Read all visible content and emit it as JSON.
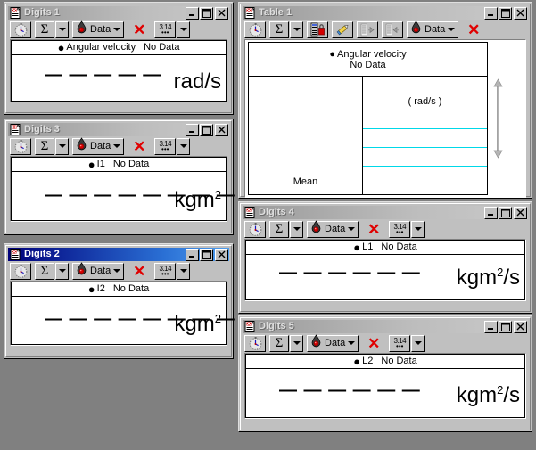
{
  "desktop": {
    "background": "#808080"
  },
  "windows": [
    {
      "id": "digits1",
      "title": "Digits 1",
      "active": false,
      "type": "digits",
      "icon": "document-meter-icon",
      "toolbar": {
        "timer_icon": "stopwatch-icon",
        "sigma_label": "Σ",
        "sigma_dropdown": "chevron-down-icon",
        "data_label": "Data",
        "data_icon": "probe-icon",
        "data_dropdown": "chevron-down-icon",
        "close_label": "✕",
        "pi_top": "3.14",
        "pi_bottom": "•••",
        "pi_dropdown": "chevron-down-icon"
      },
      "header": {
        "series": "Angular velocity",
        "status": "No Data"
      },
      "value": "— — — — —",
      "unit": "rad/s",
      "unit_sup": "",
      "unit_tail": ""
    },
    {
      "id": "digits3",
      "title": "Digits 3",
      "active": false,
      "type": "digits",
      "icon": "document-meter-icon",
      "toolbar": {
        "timer_icon": "stopwatch-icon",
        "sigma_label": "Σ",
        "sigma_dropdown": "chevron-down-icon",
        "data_label": "Data",
        "data_icon": "probe-icon",
        "data_dropdown": "chevron-down-icon",
        "close_label": "✕",
        "pi_top": "3.14",
        "pi_bottom": "•••",
        "pi_dropdown": "chevron-down-icon"
      },
      "header": {
        "series": "I1",
        "status": "No Data"
      },
      "value": "— — — — — — — —",
      "unit": "kgm",
      "unit_sup": "2",
      "unit_tail": ""
    },
    {
      "id": "digits2",
      "title": "Digits 2",
      "active": true,
      "type": "digits",
      "icon": "document-meter-icon",
      "toolbar": {
        "timer_icon": "stopwatch-icon",
        "sigma_label": "Σ",
        "sigma_dropdown": "chevron-down-icon",
        "data_label": "Data",
        "data_icon": "probe-icon",
        "data_dropdown": "chevron-down-icon",
        "close_label": "✕",
        "pi_top": "3.14",
        "pi_bottom": "•••",
        "pi_dropdown": "chevron-down-icon"
      },
      "header": {
        "series": "I2",
        "status": "No Data"
      },
      "value": "— — — — — — — —",
      "unit": "kgm",
      "unit_sup": "2",
      "unit_tail": ""
    },
    {
      "id": "table1",
      "title": "Table 1",
      "active": false,
      "type": "table",
      "icon": "document-meter-icon",
      "toolbar": {
        "timer_icon": "stopwatch-icon",
        "sigma_label": "Σ",
        "sigma_dropdown": "chevron-down-icon",
        "lock_icon": "list-lock-icon",
        "edit_icon": "pencil-icon",
        "insert_left_icon": "insert-column-left-icon",
        "insert_right_icon": "insert-column-right-icon",
        "data_label": "Data",
        "data_icon": "probe-icon",
        "data_dropdown": "chevron-down-icon",
        "close_label": "✕"
      },
      "header": {
        "series": "Angular velocity",
        "status": "No Data"
      },
      "column_unit": "( rad/s )",
      "row_label_empty": "",
      "mean_label": "Mean",
      "mean_value": "",
      "scroll_icon": "vertical-resize-arrows-icon"
    },
    {
      "id": "digits4",
      "title": "Digits 4",
      "active": false,
      "type": "digits",
      "icon": "document-meter-icon",
      "toolbar": {
        "timer_icon": "stopwatch-icon",
        "sigma_label": "Σ",
        "sigma_dropdown": "chevron-down-icon",
        "data_label": "Data",
        "data_icon": "probe-icon",
        "data_dropdown": "chevron-down-icon",
        "close_label": "✕",
        "pi_top": "3.14",
        "pi_bottom": "•••",
        "pi_dropdown": "chevron-down-icon"
      },
      "header": {
        "series": "L1",
        "status": "No Data"
      },
      "value": "— — — — — —",
      "unit": "kgm",
      "unit_sup": "2",
      "unit_tail": "/s"
    },
    {
      "id": "digits5",
      "title": "Digits 5",
      "active": false,
      "type": "digits",
      "icon": "document-meter-icon",
      "toolbar": {
        "timer_icon": "stopwatch-icon",
        "sigma_label": "Σ",
        "sigma_dropdown": "chevron-down-icon",
        "data_label": "Data",
        "data_icon": "probe-icon",
        "data_dropdown": "chevron-down-icon",
        "close_label": "✕",
        "pi_top": "3.14",
        "pi_bottom": "•••",
        "pi_dropdown": "chevron-down-icon"
      },
      "header": {
        "series": "L2",
        "status": "No Data"
      },
      "value": "— — — — — —",
      "unit": "kgm",
      "unit_sup": "2",
      "unit_tail": "/s"
    }
  ],
  "window_buttons": {
    "minimize": "minimize-icon",
    "maximize": "maximize-icon",
    "close": "close-icon"
  },
  "colors": {
    "face": "#c0c0c0",
    "desktop": "#808080",
    "active_title": "#00007b",
    "inactive_title": "#9a9a9a",
    "accent_red": "#e00000",
    "table_row_line": "#00d8e8"
  }
}
